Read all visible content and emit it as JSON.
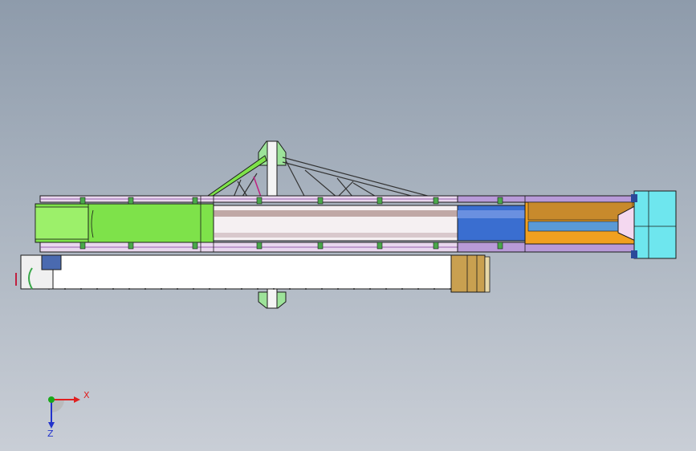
{
  "triad": {
    "x_label": "X",
    "z_label": "Z",
    "x_color": "#e02020",
    "y_color": "#1aa81a",
    "z_color": "#2233cc"
  },
  "colors": {
    "background_top": "#8e9bab",
    "background_bottom": "#c9ced6",
    "green_section": "#7ee24a",
    "blue_section": "#3a6ed0",
    "orange_section": "#f0a020",
    "cyan_block": "#6ee6ee",
    "tan_block": "#c9a050",
    "outline": "#1a1a1a"
  },
  "icons": [
    "coordinate-triad-icon"
  ]
}
